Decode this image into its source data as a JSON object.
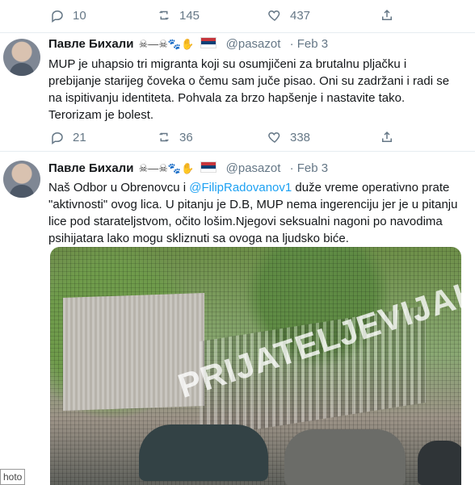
{
  "top_actions": {
    "replies": "10",
    "retweets": "145",
    "likes": "437"
  },
  "tweet1": {
    "name": "Павле Бихали",
    "decor": "☠—☠🐾✋",
    "handle": "@pasazot",
    "date": "· Feb 3",
    "text": "MUP je uhapsio tri migranta koji su osumjičeni za brutalnu pljačku i prebijanje starijeg čoveka o čemu sam juče pisao. Oni su zadržani i radi se na ispitivanju identiteta. Pohvala za brzo hapšenje i nastavite tako. Terorizam je bolest.",
    "replies": "21",
    "retweets": "36",
    "likes": "338"
  },
  "tweet2": {
    "name": "Павле Бихали",
    "decor": "☠—☠🐾✋",
    "handle": "@pasazot",
    "date": "· Feb 3",
    "text_before": "Naš Odbor u Obrenovcu i ",
    "mention": "@FilipRadovanov1",
    "text_after": " duže vreme operativno prate \"aktivnosti\" ovog lica. U pitanju je D.B, MUP nema ingerenciju jer je u pitanju lice pod starateljstvom, očito lošim.Njegovi seksualni nagoni po navodima psihijatara lako mogu skliznuti sa ovoga na ljudsko biće.",
    "watermark": "PRIJATELJEVIJAHU",
    "photo_label": "hoto"
  },
  "colors": {
    "text": "#14171a",
    "muted": "#657786",
    "link": "#1da1f2",
    "divider": "#e6ecf0"
  },
  "icons": [
    "reply-icon",
    "retweet-icon",
    "like-icon",
    "share-icon"
  ]
}
